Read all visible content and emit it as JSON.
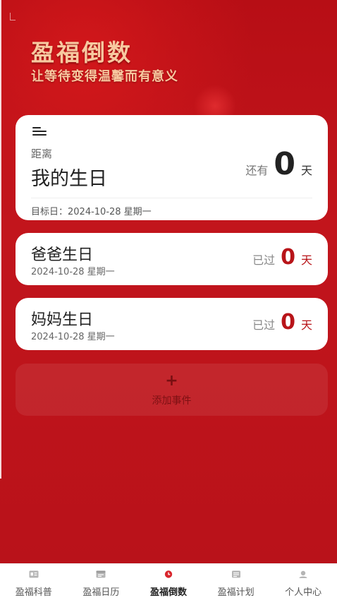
{
  "header": {
    "title": "盈福倒数",
    "subtitle": "让等待变得温馨而有意义"
  },
  "main_event": {
    "distance_label": "距离",
    "name": "我的生日",
    "count_prefix": "还有",
    "count": "0",
    "count_unit": "天",
    "target_date": "目标日：2024-10-28 星期一"
  },
  "events": [
    {
      "name": "爸爸生日",
      "date": "2024-10-28 星期一",
      "count_prefix": "已过",
      "count": "0",
      "count_unit": "天"
    },
    {
      "name": "妈妈生日",
      "date": "2024-10-28 星期一",
      "count_prefix": "已过",
      "count": "0",
      "count_unit": "天"
    }
  ],
  "add_event": {
    "icon": "+",
    "label": "添加事件"
  },
  "tabs": [
    {
      "label": "盈福科普",
      "icon": "card-icon",
      "active": false
    },
    {
      "label": "盈福日历",
      "icon": "calendar-icon",
      "active": false
    },
    {
      "label": "盈福倒数",
      "icon": "countdown-icon",
      "active": true
    },
    {
      "label": "盈福计划",
      "icon": "plan-icon",
      "active": false
    },
    {
      "label": "个人中心",
      "icon": "user-icon",
      "active": false
    }
  ],
  "colors": {
    "brand_red": "#c0141b",
    "title_gold": "#f7c9a0",
    "count_red": "#b81419"
  }
}
